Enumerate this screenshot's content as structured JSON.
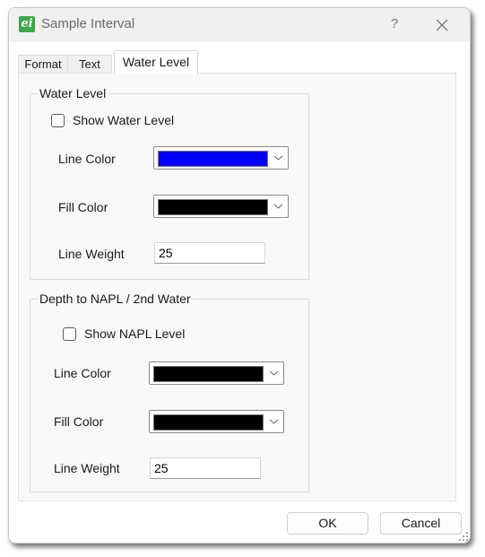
{
  "window": {
    "title": "Sample Interval",
    "app_icon_glyph": "ei",
    "help_label": "?",
    "icons": {
      "app": "app-logo-icon",
      "close": "close-icon",
      "help": "help-icon",
      "resize": "resize-grip-icon"
    }
  },
  "tabs": [
    {
      "label": "Format",
      "active": false
    },
    {
      "label": "Text",
      "active": false
    },
    {
      "label": "Water Level",
      "active": true
    }
  ],
  "water_level": {
    "group_label": "Water Level",
    "show_label": "Show Water Level",
    "show_checked": false,
    "line_color_label": "Line Color",
    "line_color": "#0000ff",
    "fill_color_label": "Fill Color",
    "fill_color": "#000000",
    "line_weight_label": "Line Weight",
    "line_weight": "25"
  },
  "napl": {
    "group_label": "Depth to NAPL / 2nd Water",
    "show_label": "Show NAPL Level",
    "show_checked": false,
    "line_color_label": "Line Color",
    "line_color": "#000000",
    "fill_color_label": "Fill Color",
    "fill_color": "#000000",
    "line_weight_label": "Line Weight",
    "line_weight": "25"
  },
  "footer": {
    "ok_label": "OK",
    "cancel_label": "Cancel"
  }
}
